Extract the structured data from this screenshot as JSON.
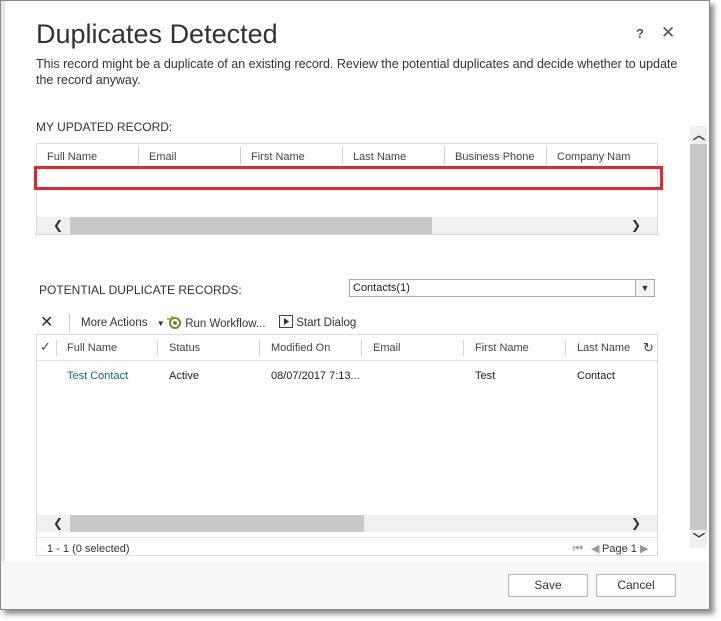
{
  "dialog": {
    "title": "Duplicates Detected",
    "help": "?",
    "close": "✕",
    "description": "This record might be a duplicate of an existing record. Review the potential duplicates and decide whether to update the record anyway."
  },
  "updated_record": {
    "label": "MY UPDATED RECORD:",
    "columns": [
      "Full Name",
      "Email",
      "First Name",
      "Last Name",
      "Business Phone",
      "Company Nam"
    ]
  },
  "potential": {
    "label": "POTENTIAL DUPLICATE RECORDS:",
    "select_value": "Contacts(1)",
    "toolbar": {
      "delete_icon": "✕",
      "more_actions": "More Actions",
      "run_workflow": "Run Workflow...",
      "start_dialog": "Start Dialog"
    },
    "columns": [
      "Full Name",
      "Status",
      "Modified On",
      "Email",
      "First Name",
      "Last Name"
    ],
    "rows": [
      {
        "full_name": "Test Contact",
        "status": "Active",
        "modified_on": "08/07/2017 7:13...",
        "email": "",
        "first_name": "Test",
        "last_name": "Contact"
      }
    ],
    "selection_status": "1 - 1 (0 selected)",
    "page_label": "Page 1"
  },
  "buttons": {
    "save": "Save",
    "cancel": "Cancel"
  },
  "colors": {
    "highlight": "#e0282e",
    "link": "#1160b7"
  }
}
